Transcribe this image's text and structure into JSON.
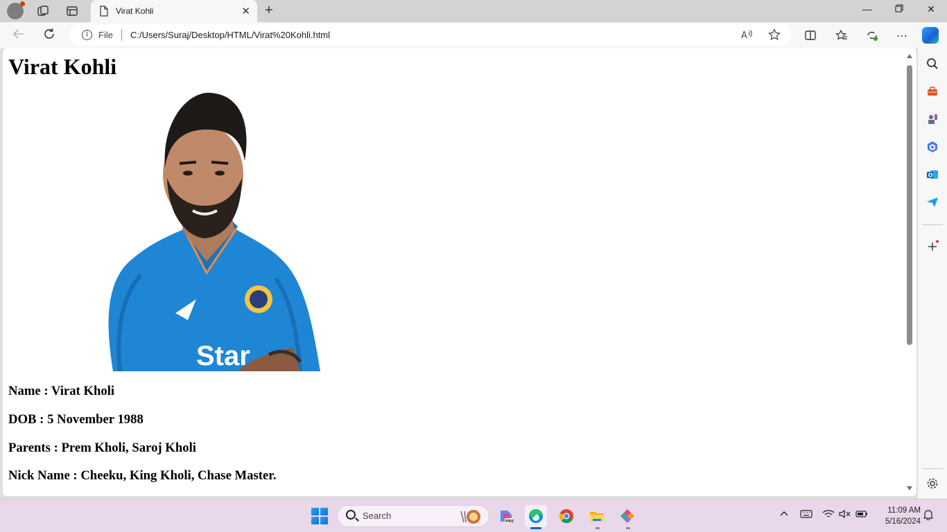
{
  "browser": {
    "tab_title": "Virat Kohli",
    "address_prefix": "File",
    "url": "C:/Users/Suraj/Desktop/HTML/Virat%20Kohli.html"
  },
  "page": {
    "heading": "Virat Kohli",
    "info_lines": [
      "Name : Virat Kholi",
      "DOB : 5 November 1988",
      "Parents : Prem Kholi, Saroj Kholi",
      "Nick Name : Cheeku, King Kholi, Chase Master."
    ]
  },
  "taskbar": {
    "search_placeholder": "Search",
    "time": "11:09 AM",
    "date": "5/16/2024"
  },
  "colors": {
    "jersey_blue": "#1f86d6",
    "accent": "#0067c0"
  }
}
